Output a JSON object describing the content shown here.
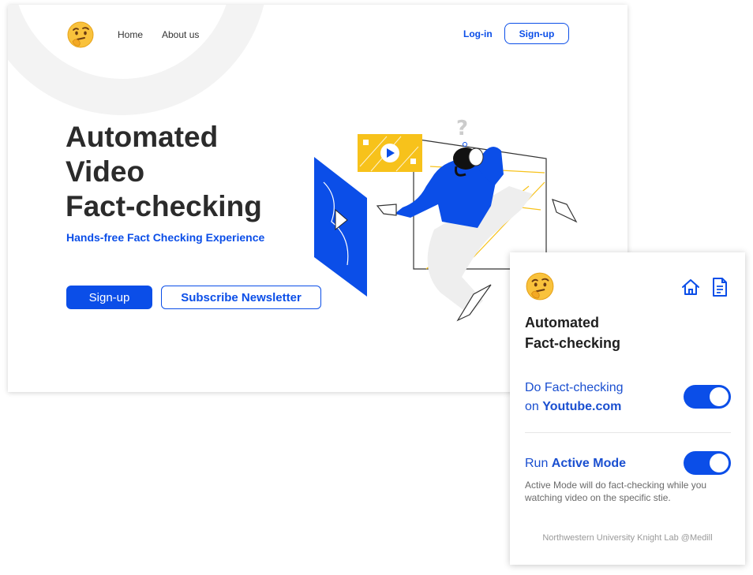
{
  "landing": {
    "nav": {
      "home": "Home",
      "about": "About us",
      "login": "Log-in",
      "signup": "Sign-up"
    },
    "hero": {
      "title_line1": "Automated",
      "title_line2": "Video",
      "title_line3": "Fact-checking",
      "subtitle": "Hands-free Fact Checking Experience",
      "primary_button": "Sign-up",
      "secondary_button": "Subscribe Newsletter"
    }
  },
  "popup": {
    "title_line1": "Automated",
    "title_line2": "Fact-checking",
    "option1": {
      "line1": "Do Fact-checking",
      "line2_prefix": "on ",
      "line2_bold": "Youtube.com",
      "enabled": true
    },
    "option2": {
      "label_prefix": "Run ",
      "label_bold": "Active Mode",
      "description": "Active Mode will do fact-checking while you watching video on the specific stie.",
      "enabled": true
    },
    "footer": "Northwestern University Knight Lab @Medill"
  },
  "icons": {
    "logo": "thinking-face-emoji",
    "home": "home-icon",
    "document": "document-icon"
  },
  "colors": {
    "accent": "#0b4ee8",
    "illustration_yellow": "#f7c21b",
    "text_dark": "#2b2b2b"
  }
}
